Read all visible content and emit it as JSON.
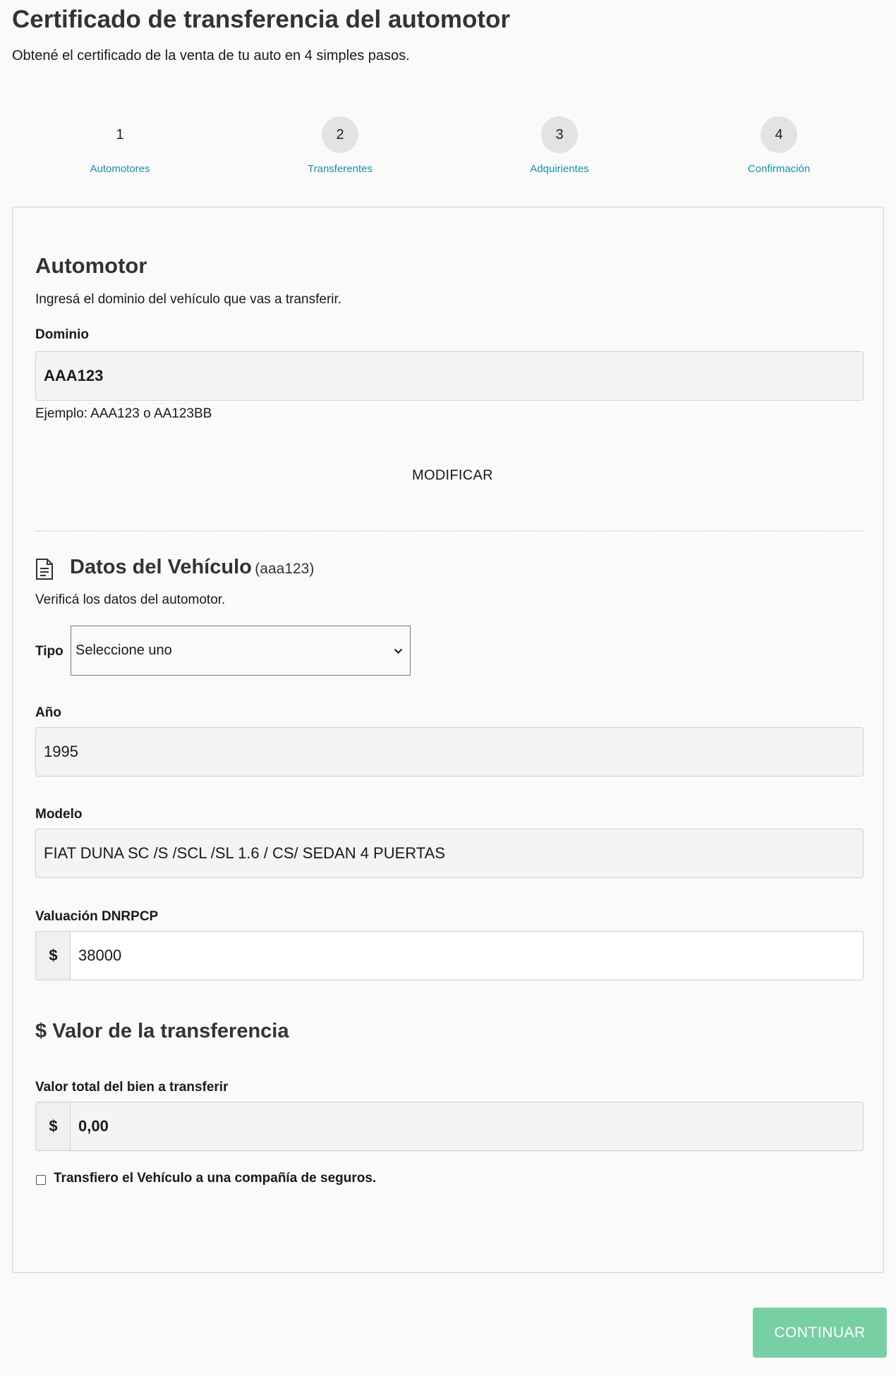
{
  "header": {
    "title": "Certificado de transferencia del automotor",
    "subtitle": "Obtené el certificado de la venta de tu auto en 4 simples pasos."
  },
  "stepper": {
    "steps": [
      {
        "number": "1",
        "label": "Automotores",
        "state": "active"
      },
      {
        "number": "2",
        "label": "Transferentes",
        "state": "pending"
      },
      {
        "number": "3",
        "label": "Adquirientes",
        "state": "pending"
      },
      {
        "number": "4",
        "label": "Confirmación",
        "state": "pending"
      }
    ]
  },
  "automotor": {
    "title": "Automotor",
    "description": "Ingresá el dominio del vehículo que vas a transferir.",
    "dominio_label": "Dominio",
    "dominio_value": "AAA123",
    "dominio_hint": "Ejemplo: AAA123 o AA123BB",
    "modify_label": "MODIFICAR"
  },
  "vehiculo": {
    "icon": "document-icon",
    "title": "Datos del Vehículo",
    "domain_tag": "(aaa123)",
    "description": "Verificá los datos del automotor.",
    "tipo_label": "Tipo",
    "tipo_selected": "Seleccione uno",
    "anio_label": "Año",
    "anio_value": "1995",
    "modelo_label": "Modelo",
    "modelo_value": "FIAT DUNA SC /S /SCL /SL 1.6 / CS/ SEDAN 4 PUERTAS",
    "valuacion_label": "Valuación DNRPCP",
    "valuacion_currency": "$",
    "valuacion_value": "38000"
  },
  "transferencia": {
    "icon": "dollar-icon",
    "title_symbol": "$",
    "title": "Valor de la transferencia",
    "valor_label": "Valor total del bien a transferir",
    "valor_currency": "$",
    "valor_value": "0,00",
    "seguro_checkbox_label": "Transfiero el Vehículo a una compañía de seguros.",
    "seguro_checked": false
  },
  "footer": {
    "continue_label": "CONTINUAR"
  },
  "colors": {
    "accent_teal": "#1a8fa6",
    "continue_green": "#79cfa4"
  }
}
